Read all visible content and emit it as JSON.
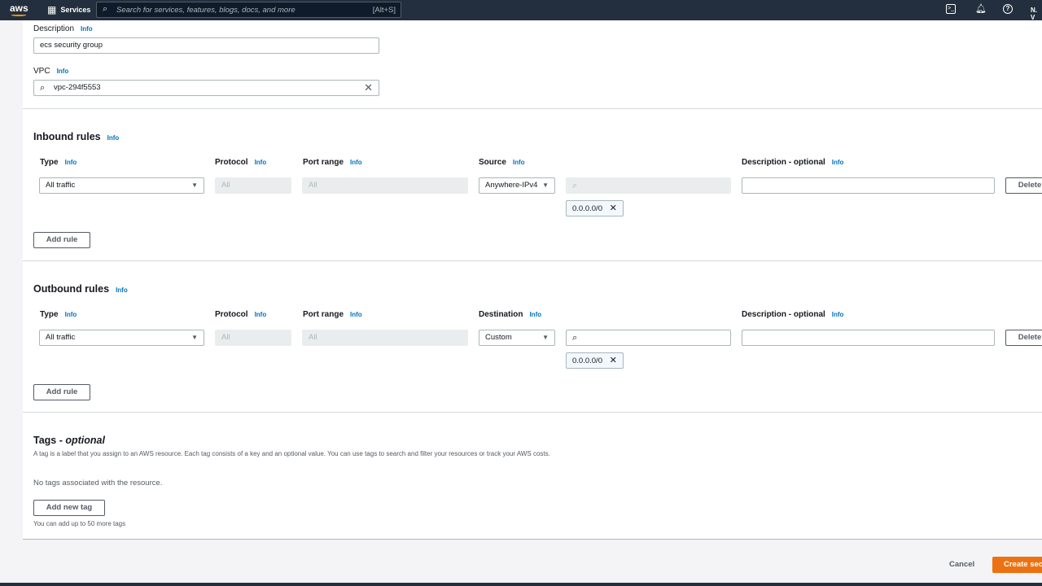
{
  "topbar": {
    "logo": "aws",
    "services": "Services",
    "search_placeholder": "Search for services, features, blogs, docs, and more",
    "shortcut": "[Alt+S]",
    "region": "N. V"
  },
  "basic": {
    "description_label": "Description",
    "description_value": "ecs security group",
    "vpc_label": "VPC",
    "vpc_value": "vpc-294f5553",
    "info": "Info"
  },
  "inbound": {
    "title": "Inbound rules",
    "type_label": "Type",
    "protocol_label": "Protocol",
    "port_label": "Port range",
    "source_label": "Source",
    "desc_label": "Description - optional",
    "type_value": "All traffic",
    "protocol_value": "All",
    "port_value": "All",
    "source_value": "Anywhere-IPv4",
    "cidr": "0.0.0.0/0",
    "delete": "Delete",
    "add_rule": "Add rule"
  },
  "outbound": {
    "title": "Outbound rules",
    "type_label": "Type",
    "protocol_label": "Protocol",
    "port_label": "Port range",
    "dest_label": "Destination",
    "desc_label": "Description - optional",
    "type_value": "All traffic",
    "protocol_value": "All",
    "port_value": "All",
    "dest_value": "Custom",
    "cidr": "0.0.0.0/0",
    "delete": "Delete",
    "add_rule": "Add rule"
  },
  "tags": {
    "title": "Tags - ",
    "title_optional": "optional",
    "description": "A tag is a label that you assign to an AWS resource. Each tag consists of a key and an optional value. You can use tags to search and filter your resources or track your AWS costs.",
    "empty": "No tags associated with the resource.",
    "add": "Add new tag",
    "limit": "You can add up to 50 more tags"
  },
  "footer": {
    "cancel": "Cancel",
    "create": "Create security group"
  }
}
